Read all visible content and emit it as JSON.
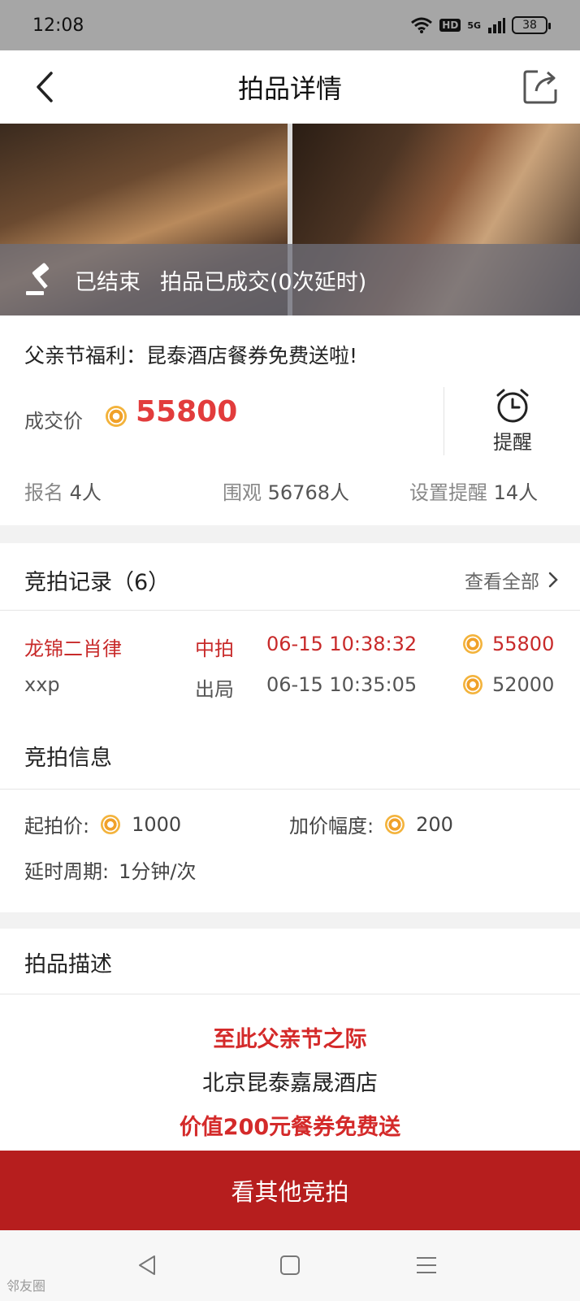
{
  "status": {
    "time": "12:08",
    "battery": "38",
    "net": "5G",
    "hd": "HD"
  },
  "header": {
    "title": "拍品详情"
  },
  "banner": {
    "status": "已结束",
    "result": "拍品已成交(0次延时)"
  },
  "item": {
    "title": "父亲节福利：昆泰酒店餐券免费送啦!",
    "price_label": "成交价",
    "price": "55800",
    "remind_label": "提醒",
    "signup_label": "报名",
    "signup_value": "4人",
    "views_label": "围观",
    "views_value": "56768人",
    "remind_set_label": "设置提醒",
    "remind_set_value": "14人"
  },
  "records": {
    "title": "竞拍记录（6）",
    "view_all": "查看全部",
    "rows": [
      {
        "name": "龙锦二肖律",
        "status": "中拍",
        "time": "06-15 10:38:32",
        "amount": "55800"
      },
      {
        "name": "xxp",
        "status": "出局",
        "time": "06-15 10:35:05",
        "amount": "52000"
      }
    ]
  },
  "auction_info": {
    "title": "竞拍信息",
    "start_label": "起拍价:",
    "start_value": "1000",
    "increment_label": "加价幅度:",
    "increment_value": "200",
    "delay_label": "延时周期:",
    "delay_value": "1分钟/次"
  },
  "description": {
    "title": "拍品描述",
    "line1": "至此父亲节之际",
    "line2": "北京昆泰嘉晟酒店",
    "line3": "价值200元餐券免费送"
  },
  "bottom_button": "看其他竞拍",
  "watermark": "邻友圈",
  "colors": {
    "accent_red": "#e23c3c",
    "button_red": "#b61e1e",
    "coin_gold": "#f0a12a"
  }
}
